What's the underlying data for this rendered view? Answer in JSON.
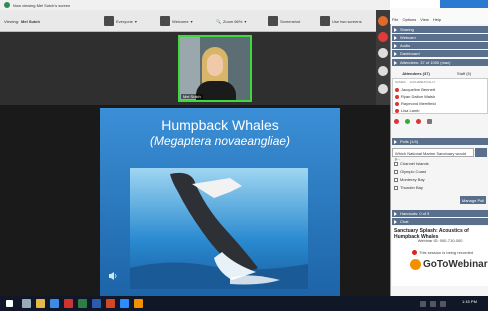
{
  "zoom": {
    "banner": "Now viewing Mel Sutch's screen",
    "viewing_label": "Viewing:",
    "viewing_name": "Mel Sutch",
    "toolbar": {
      "everyone": "Everyone",
      "welcome": "Welcome",
      "zoom_level": "Zoom 66%",
      "screenshot": "Screenshot",
      "side_by_side": "Use two screens"
    },
    "speaker_name": "Mel Sutch"
  },
  "slide": {
    "title": "Humpback Whales",
    "subtitle": "(Megaptera novaeangliae)"
  },
  "gotowebinar": {
    "menu": [
      "File",
      "Options",
      "View",
      "Help"
    ],
    "sections": {
      "sharing": "Sharing",
      "webcam": "Webcam",
      "audio": "Audio",
      "dashboard": "Dashboard",
      "attendees": "Attendees: 37 of 1000 (max)",
      "polls": "Polls (1/4)",
      "handouts": "Handouts: 0 of 5",
      "chat": "Chat"
    },
    "attendee_tabs": [
      "Attendees (37)",
      "Staff (5)"
    ],
    "attendee_columns": [
      "NAMES",
      "ALPHABETICALLY"
    ],
    "attendees": [
      "Jacqueline Bennett",
      "Ryan Dalton Walsh",
      "Raymond Merrifield",
      "Lisa Lamb"
    ],
    "poll_question": "Which National Marine Sanctuary would y...",
    "poll_options": [
      "Channel Islands",
      "Olympic Coast",
      "Monterey Bay",
      "Thunder Bay"
    ],
    "poll_button": "Manage Poll",
    "webinar_title": "Sanctuary Splash: Acoustics of Humpback Whales",
    "webinar_id": "Webinar ID: 000-710-000",
    "recording": "This session is being recorded",
    "brand": "GoToWebinar"
  },
  "taskbar": {
    "clock": "1:15 PM"
  }
}
